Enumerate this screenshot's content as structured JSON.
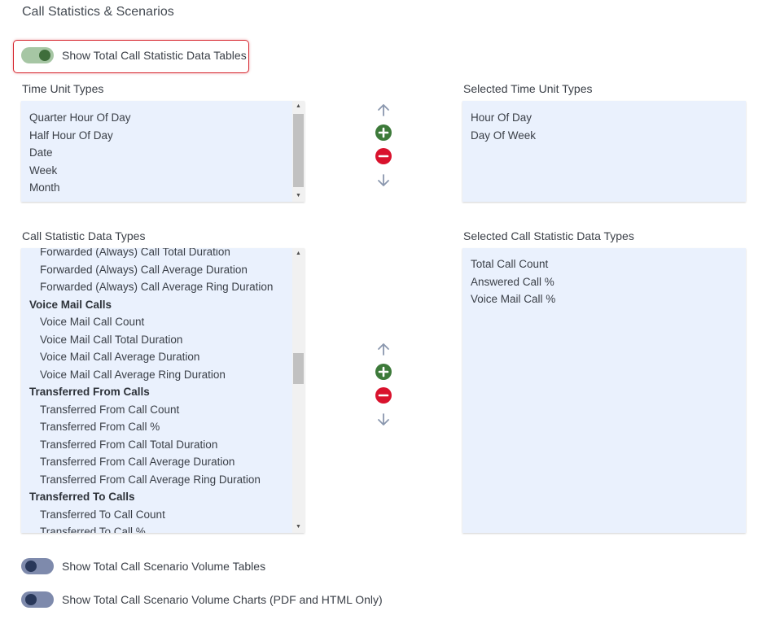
{
  "page": {
    "title": "Call Statistics & Scenarios"
  },
  "toggles": {
    "total_data_tables": {
      "label": "Show Total Call Statistic Data Tables",
      "state": "on"
    },
    "scenario_volume_tables": {
      "label": "Show Total Call Scenario Volume Tables",
      "state": "off"
    },
    "scenario_volume_charts": {
      "label": "Show Total Call Scenario Volume Charts (PDF and HTML Only)",
      "state": "off"
    }
  },
  "time_units": {
    "available_label": "Time Unit Types",
    "selected_label": "Selected Time Unit Types",
    "available": [
      "Quarter Hour Of Day",
      "Half Hour Of Day",
      "Date",
      "Week",
      "Month"
    ],
    "selected": [
      "Hour Of Day",
      "Day Of Week"
    ]
  },
  "data_types": {
    "available_label": "Call Statistic Data Types",
    "selected_label": "Selected Call Statistic Data Types",
    "available": [
      {
        "text": "Forwarded (Always) Call Total Duration",
        "kind": "child"
      },
      {
        "text": "Forwarded (Always) Call Average Duration",
        "kind": "child"
      },
      {
        "text": "Forwarded (Always) Call Average Ring Duration",
        "kind": "child"
      },
      {
        "text": "Voice Mail Calls",
        "kind": "group"
      },
      {
        "text": "Voice Mail Call Count",
        "kind": "child"
      },
      {
        "text": "Voice Mail Call Total Duration",
        "kind": "child"
      },
      {
        "text": "Voice Mail Call Average Duration",
        "kind": "child"
      },
      {
        "text": "Voice Mail Call Average Ring Duration",
        "kind": "child"
      },
      {
        "text": "Transferred From Calls",
        "kind": "group"
      },
      {
        "text": "Transferred From Call Count",
        "kind": "child"
      },
      {
        "text": "Transferred From Call %",
        "kind": "child"
      },
      {
        "text": "Transferred From Call Total Duration",
        "kind": "child"
      },
      {
        "text": "Transferred From Call Average Duration",
        "kind": "child"
      },
      {
        "text": "Transferred From Call Average Ring Duration",
        "kind": "child"
      },
      {
        "text": "Transferred To Calls",
        "kind": "group"
      },
      {
        "text": "Transferred To Call Count",
        "kind": "child"
      },
      {
        "text": "Transferred To Call %",
        "kind": "child"
      }
    ],
    "selected": [
      "Total Call Count",
      "Answered Call %",
      "Voice Mail Call %"
    ]
  },
  "icons": {
    "move_up": "arrow-up-icon",
    "add": "plus-circle-icon",
    "remove": "minus-circle-icon",
    "move_down": "arrow-down-icon"
  },
  "colors": {
    "list_bg": "#eaf1fd",
    "add_green": "#3d7a3a",
    "remove_red": "#d9122d",
    "toggle_on": "#3f6e3b",
    "toggle_off": "#29385a",
    "highlight": "#d6262e"
  }
}
